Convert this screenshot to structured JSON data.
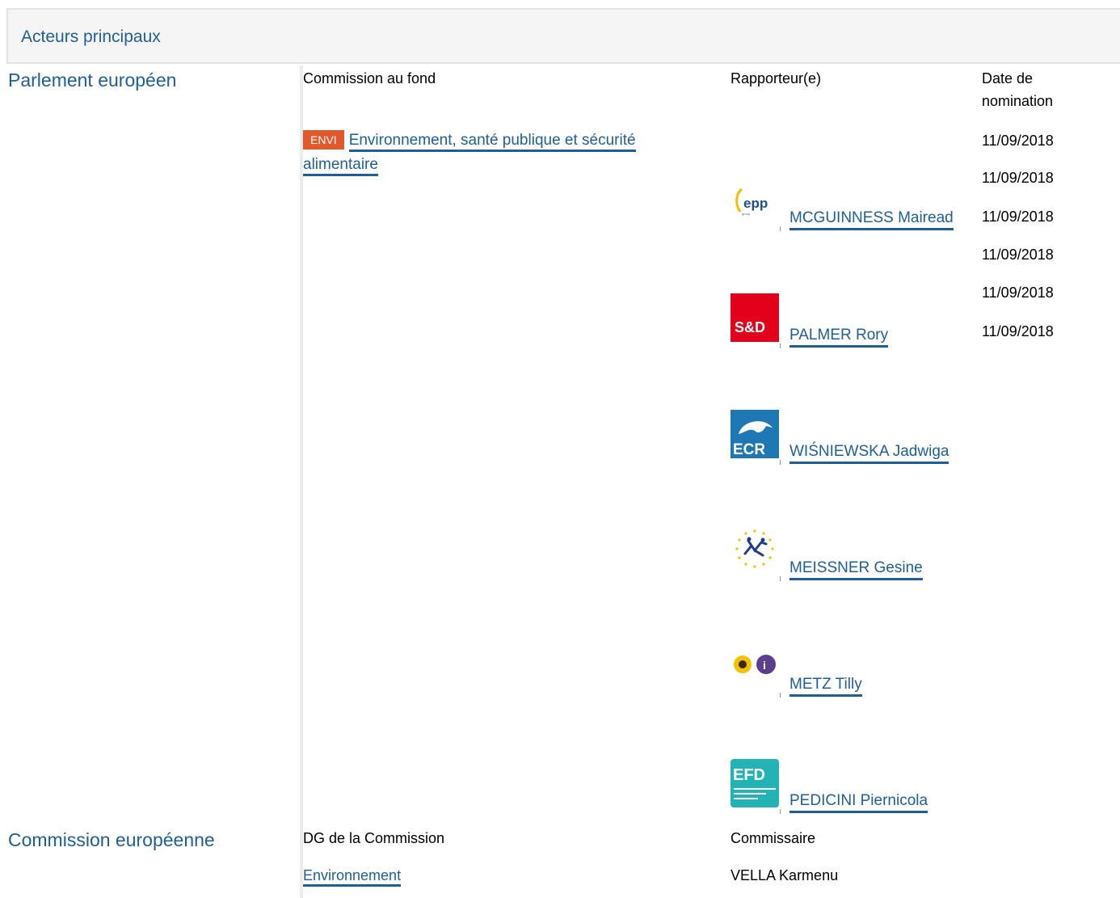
{
  "section": {
    "title": "Acteurs principaux"
  },
  "parliament": {
    "label": "Parlement européen",
    "committee_header": "Commission au fond",
    "rapporteur_header": "Rapporteur(e)",
    "date_header_line1": "Date de",
    "date_header_line2": "nomination",
    "committee_code": "ENVI",
    "committee_name": "Environnement, santé publique et sécurité alimentaire",
    "dates": [
      "11/09/2018",
      "11/09/2018",
      "11/09/2018",
      "11/09/2018",
      "11/09/2018",
      "11/09/2018"
    ],
    "rapporteurs": [
      {
        "name": "MCGUINNESS Mairead",
        "group_logo": "epp-logo"
      },
      {
        "name": "PALMER Rory",
        "group_logo": "sd-logo"
      },
      {
        "name": "WIŚNIEWSKA Jadwiga",
        "group_logo": "ecr-logo"
      },
      {
        "name": "MEISSNER Gesine",
        "group_logo": "alde-logo"
      },
      {
        "name": "METZ Tilly",
        "group_logo": "greens-efa-logo"
      },
      {
        "name": "PEDICINI Piernicola",
        "group_logo": "efdd-logo"
      }
    ]
  },
  "commission": {
    "label": "Commission européenne",
    "dg_header": "DG de la Commission",
    "commissioner_header": "Commissaire",
    "dg_name": "Environnement",
    "commissioner_name": "VELLA Karmenu"
  },
  "colors": {
    "link": "#1f5e97",
    "badge": "#e0592a",
    "header_bg": "#f5f5f5"
  }
}
